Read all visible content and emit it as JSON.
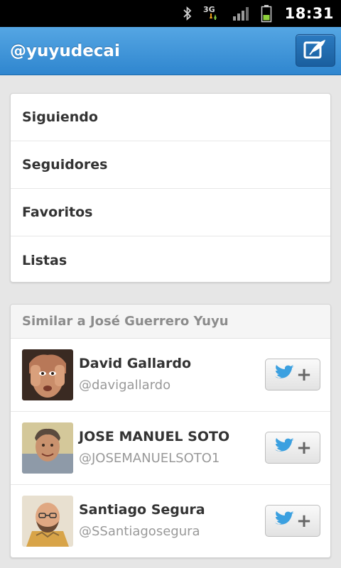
{
  "status_bar": {
    "time": "18:31",
    "icons": [
      "bluetooth-icon",
      "3g-data-icon",
      "signal-icon",
      "battery-icon"
    ],
    "network_label": "3G"
  },
  "action_bar": {
    "title": "@yuyudecai",
    "compose_icon": "compose-icon",
    "color": "#3a8fd6"
  },
  "menu": {
    "items": [
      {
        "label": "Siguiendo"
      },
      {
        "label": "Seguidores"
      },
      {
        "label": "Favoritos"
      },
      {
        "label": "Listas"
      }
    ]
  },
  "similar": {
    "header": "Similar a José Guerrero Yuyu",
    "users": [
      {
        "name": "David Gallardo",
        "handle": "@davigallardo",
        "follow_icon": "twitter-bird-icon"
      },
      {
        "name": "JOSE MANUEL SOTO",
        "handle": "@JOSEMANUELSOTO1",
        "follow_icon": "twitter-bird-icon"
      },
      {
        "name": "Santiago Segura",
        "handle": "@SSantiagosegura",
        "follow_icon": "twitter-bird-icon"
      }
    ]
  }
}
